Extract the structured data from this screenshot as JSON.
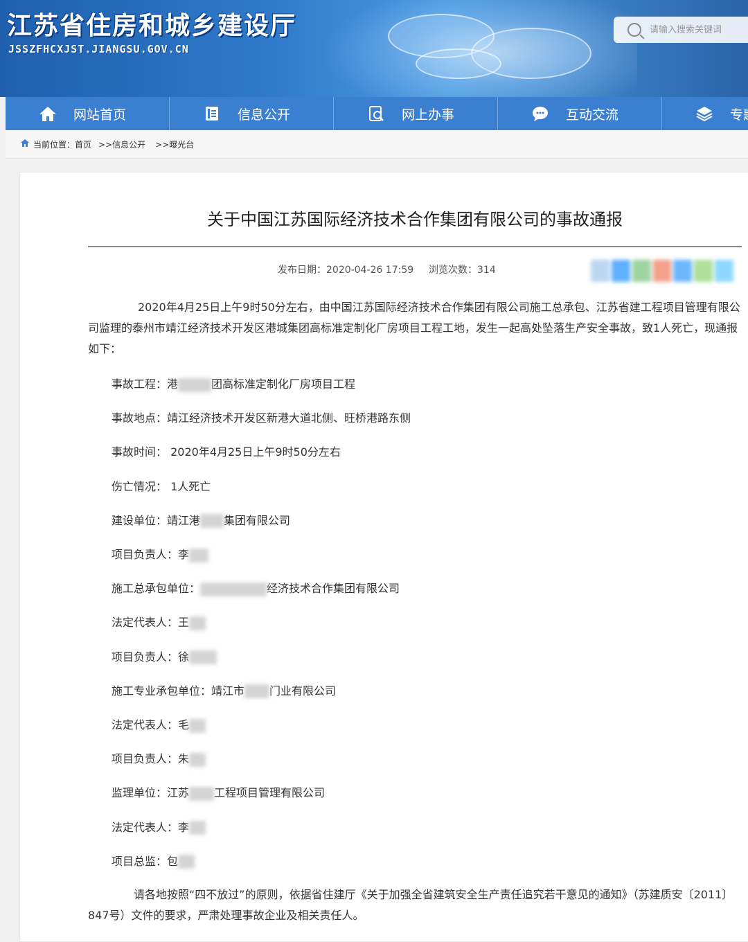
{
  "header": {
    "site_title": "江苏省住房和城乡建设厅",
    "site_domain": "JSSZFHCXJST.JIANGSU.GOV.CN",
    "search_placeholder": "请输入搜索关键词"
  },
  "nav": {
    "items": [
      {
        "label": "网站首页",
        "icon": "home-icon"
      },
      {
        "label": "信息公开",
        "icon": "document-icon"
      },
      {
        "label": "网上办事",
        "icon": "search-document-icon"
      },
      {
        "label": "互动交流",
        "icon": "chat-icon"
      },
      {
        "label": "专题",
        "icon": "layers-icon"
      }
    ]
  },
  "breadcrumb": {
    "prefix": "当前位置：",
    "home": "首页",
    "level1": ">>信息公开",
    "level2": ">>曝光台"
  },
  "article": {
    "title": "关于中国江苏国际经济技术合作集团有限公司的事故通报",
    "publish_date_label": "发布日期：2020-04-26 17:59",
    "views_label": "浏览次数：314",
    "intro": "2020年4月25日上午9时50分左右，由中国江苏国际经济技术合作集团有限公司施工总承包、江苏省建工程项目管理有限公司监理的泰州市靖江经济技术开发区港城集团高标准定制化厂房项目工程工地，发生一起高处坠落生产安全事故，致1人死亡，现通报如下：",
    "fields": [
      {
        "label": "事故工程：",
        "value_pre": "港",
        "value_post": "团高标准定制化厂房项目工程"
      },
      {
        "label": "事故地点：",
        "value_pre": "靖江经济技术开发区新港大道北侧、旺桥港路东侧",
        "value_post": ""
      },
      {
        "label": "事故时间：",
        "value_pre": " 2020年4月25日上午9时50分左右",
        "value_post": ""
      },
      {
        "label": "伤亡情况：",
        "value_pre": " 1人死亡",
        "value_post": ""
      },
      {
        "label": "建设单位：",
        "value_pre": "靖江港",
        "value_post": "集团有限公司"
      },
      {
        "label": "项目负责人：",
        "value_pre": "李",
        "value_post": ""
      },
      {
        "label": "施工总承包单位：",
        "value_pre": "",
        "value_post": "经济技术合作集团有限公司"
      },
      {
        "label": "法定代表人：",
        "value_pre": "王",
        "value_post": ""
      },
      {
        "label": "项目负责人：",
        "value_pre": "徐",
        "value_post": ""
      },
      {
        "label": "施工专业承包单位：",
        "value_pre": "靖江市",
        "value_post": "门业有限公司"
      },
      {
        "label": "法定代表人：",
        "value_pre": "毛",
        "value_post": ""
      },
      {
        "label": "项目负责人：",
        "value_pre": "朱",
        "value_post": ""
      },
      {
        "label": "监理单位：",
        "value_pre": "江苏",
        "value_post": "工程项目管理有限公司"
      },
      {
        "label": "法定代表人：",
        "value_pre": "李",
        "value_post": ""
      },
      {
        "label": "项目总监：",
        "value_pre": "包",
        "value_post": ""
      }
    ],
    "closing": "请各地按照“四不放过”的原则，依据省住建厅《关于加强全省建筑安全生产责任追究若干意见的通知》（苏建质安〔2011〕847号）文件的要求，严肃处理事故企业及相关责任人。"
  },
  "colors": {
    "nav_bg": "#3b7fd1",
    "banner_blue": "#2f79c9"
  }
}
